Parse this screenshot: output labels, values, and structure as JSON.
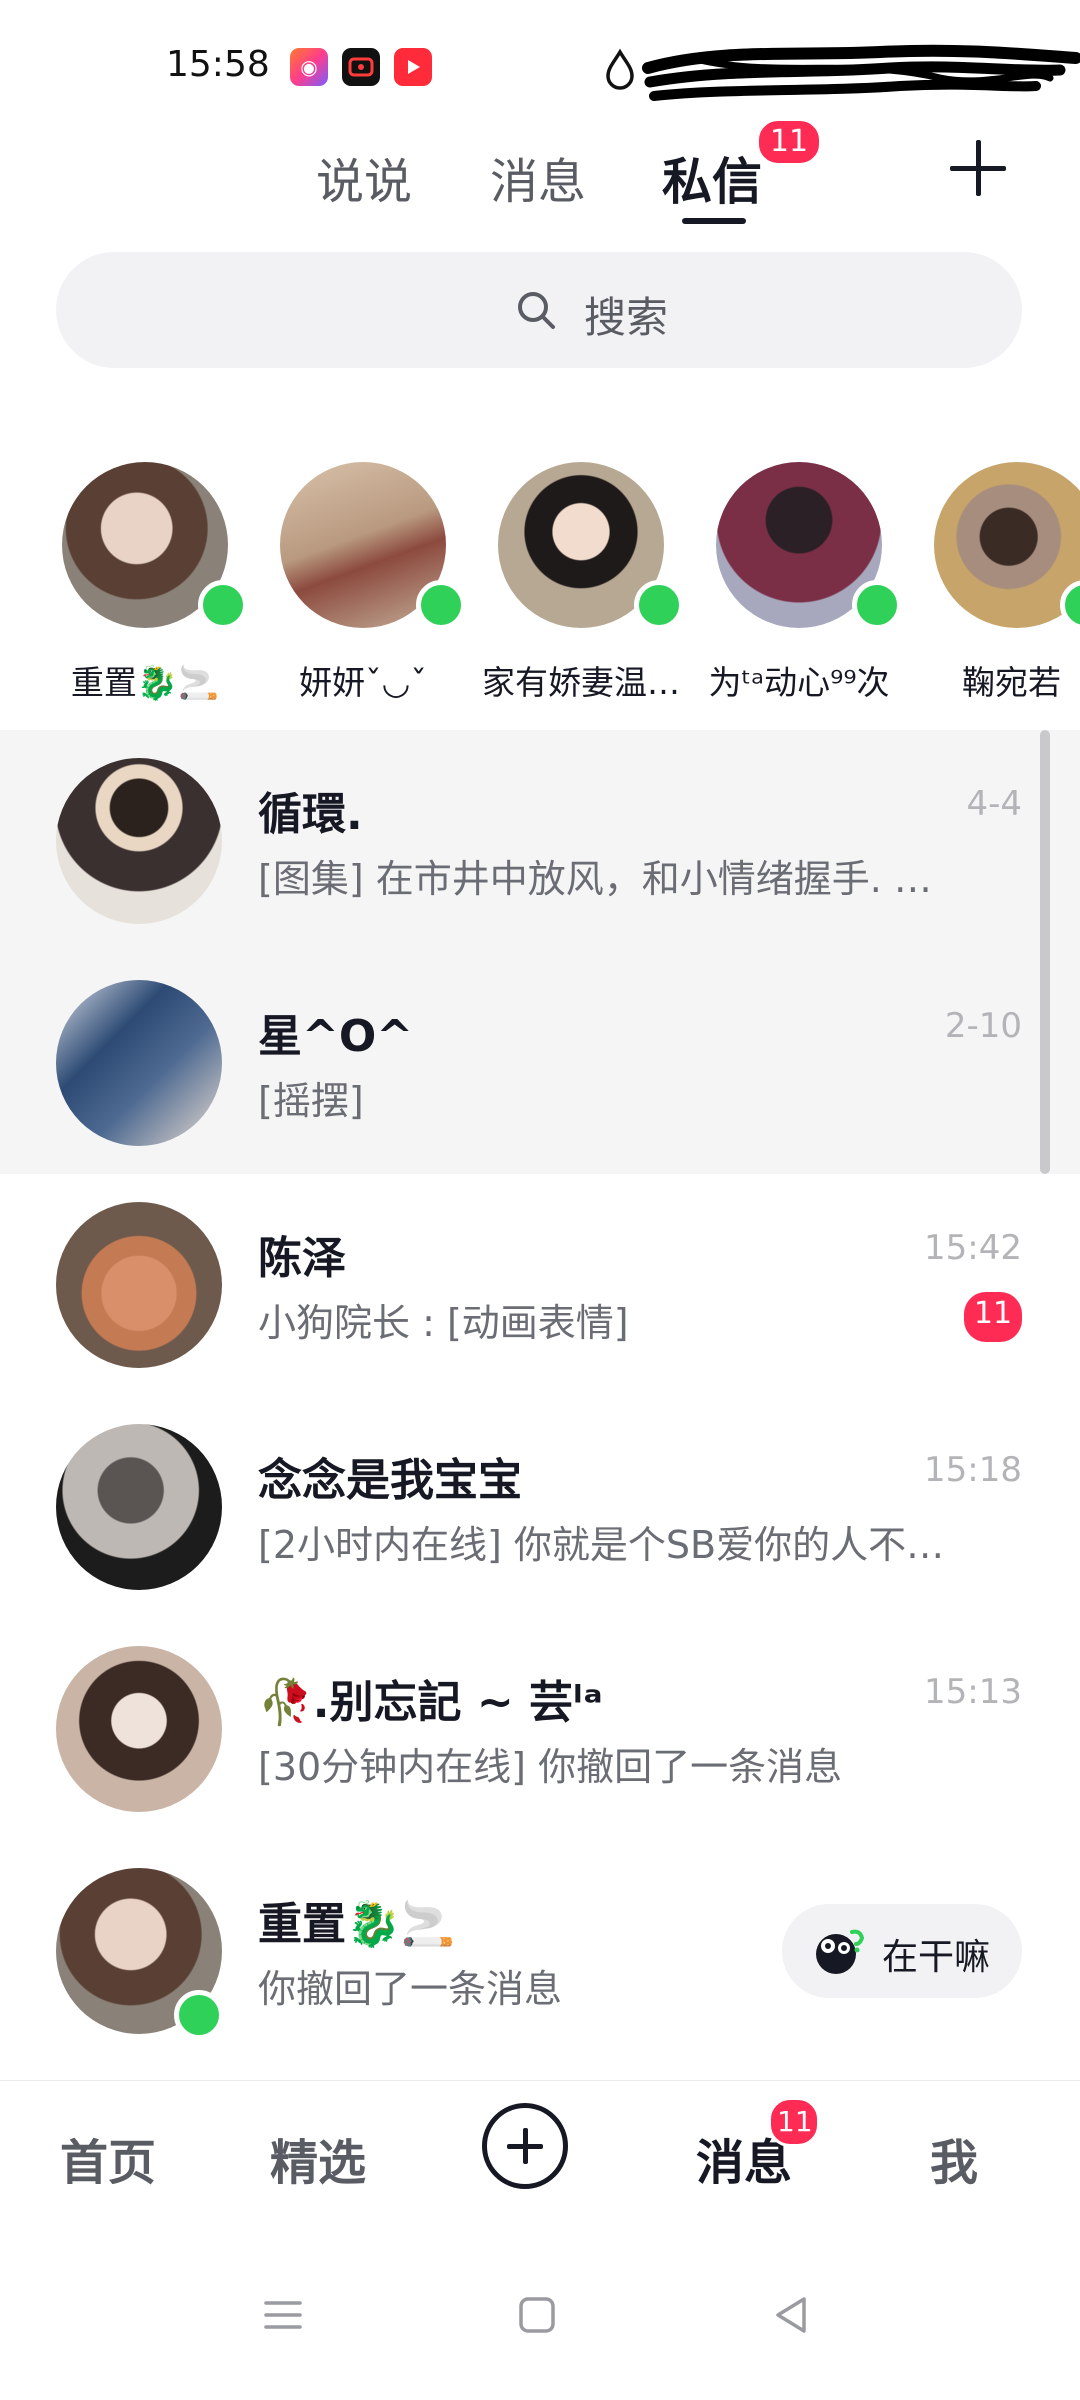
{
  "status_bar": {
    "time": "15:58",
    "apps": [
      "kuaishou-app-icon",
      "screen-record-icon",
      "video-app-icon"
    ]
  },
  "top_tabs": {
    "items": [
      "说说",
      "消息",
      "私信"
    ],
    "active": "私信",
    "badge": "11"
  },
  "search": {
    "placeholder": "搜索"
  },
  "stories": [
    {
      "name": "重置🐉🚬",
      "online": true
    },
    {
      "name": "妍妍ˇ◡ˇ",
      "online": true
    },
    {
      "name": "家有娇妻温…",
      "online": true
    },
    {
      "name": "为ᵗᵃ动心⁹⁹次",
      "online": true
    },
    {
      "name": "鞠宛若",
      "online": true
    }
  ],
  "conversations": [
    {
      "title": "循環.",
      "preview": "[图集] 在市井中放风，和小情绪握手. …",
      "time": "4-4",
      "pinned": true
    },
    {
      "title": "星^O^",
      "preview": "[摇摆]",
      "time": "2-10",
      "pinned": true
    },
    {
      "title": "陈泽",
      "preview": "小狗院长 : [动画表情]",
      "time": "15:42",
      "badge": "11"
    },
    {
      "title": "念念是我宝宝",
      "preview": "[2小时内在线] 你就是个SB爱你的人不…",
      "time": "15:18"
    },
    {
      "title": "🥀.别忘記 ~ 芸ˡᵃ",
      "preview": "[30分钟内在线] 你撤回了一条消息",
      "time": "15:13"
    },
    {
      "title": "重置🐉🚬",
      "preview": "你撤回了一条消息",
      "time": "",
      "online": true,
      "chip": "在干嘛"
    }
  ],
  "bottom_nav": {
    "items": [
      "首页",
      "精选",
      "消息",
      "我"
    ],
    "active": "消息",
    "badge": "11"
  },
  "colors": {
    "accent": "#fe2c55",
    "online": "#2fd158",
    "text_primary": "#161823",
    "text_secondary": "#6b6d74",
    "pinned_bg": "#f5f5f6"
  }
}
